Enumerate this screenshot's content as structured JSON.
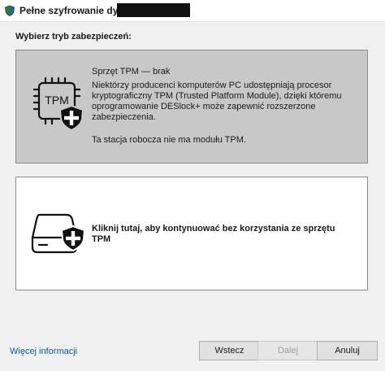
{
  "window": {
    "title": "Pełne szyfrowanie dysku:",
    "app_icon": "shield-app-icon"
  },
  "heading": "Wybierz tryb zabezpieczeń:",
  "options": {
    "tpm": {
      "title": "Sprzęt TPM — brak",
      "description": "Niektórzy producenci komputerów PC udostępniają procesor kryptograficzny TPM (Trusted Platform Module), dzięki któremu oprogramowanie DESlock+ może zapewnić rozszerzone zabezpieczenia.",
      "note": "Ta stacja robocza nie ma modułu TPM.",
      "icon_label": "TPM",
      "icon": "tpm-chip-shield-icon"
    },
    "continue": {
      "title": "Kliknij tutaj, aby kontynuować bez korzystania ze sprzętu TPM",
      "icon": "drive-shield-icon"
    }
  },
  "footer": {
    "more_info": "Więcej informacji",
    "back": "Wstecz",
    "next": "Dalej",
    "cancel": "Anuluj"
  },
  "colors": {
    "link": "#0b57b0",
    "selected_option_bg": "#c8c8c8",
    "option_border": "#8c8c8c"
  }
}
